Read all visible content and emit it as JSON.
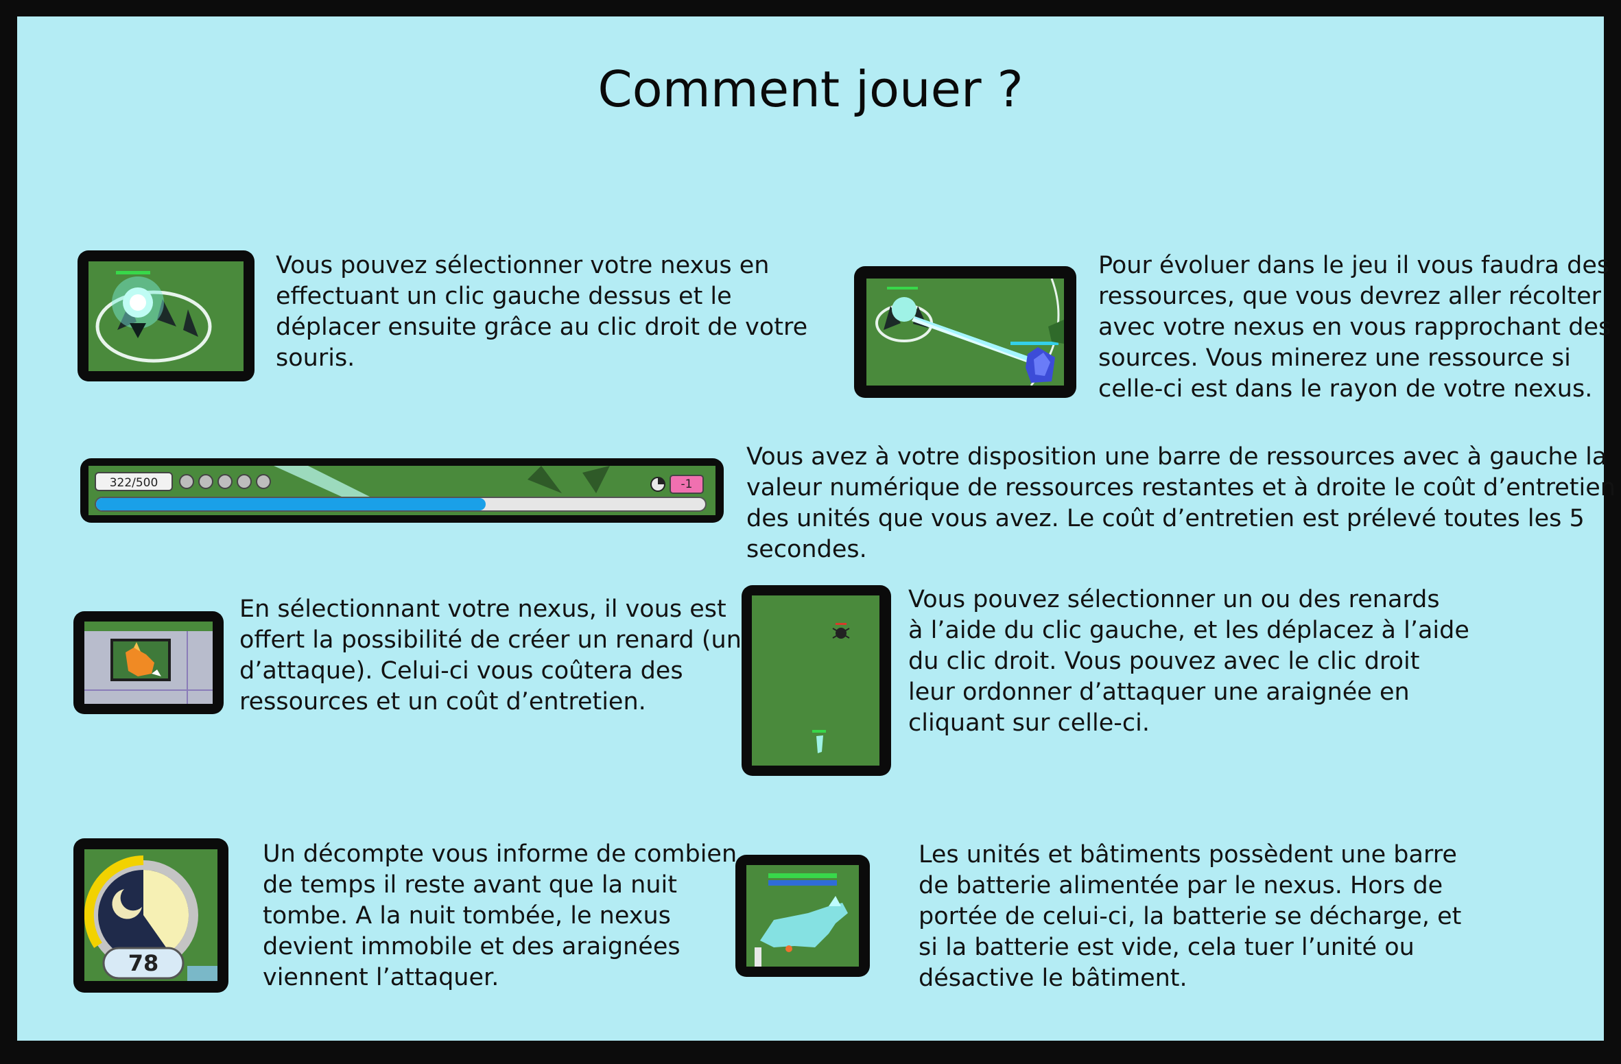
{
  "title": "Comment jouer ?",
  "sections": [
    {
      "text": "Vous pouvez sélectionner votre nexus en\neffectuant un clic gauche dessus et le\ndéplacer ensuite grâce au clic droit de votre\nsouris."
    },
    {
      "text": "Pour évoluer dans le jeu il vous faudra des\nressources, que vous devrez aller récolter\navec votre nexus en vous rapprochant des\nsources. Vous minerez une ressource si\ncelle-ci est dans le rayon de votre nexus."
    },
    {
      "text": "Vous avez à votre disposition une barre de ressources avec à gauche la\nvaleur numérique de ressources restantes et à droite le coût d’entretien\ndes unités que vous avez. Le coût d’entretien est prélevé toutes les 5\nsecondes."
    },
    {
      "text": "En sélectionnant votre nexus, il vous est\noffert la possibilité de créer un renard (unité\nd’attaque). Celui-ci vous coûtera des\nressources et un coût d’entretien."
    },
    {
      "text": "Vous pouvez sélectionner un ou des renards\nà l’aide du clic gauche, et les déplacez à l’aide\ndu clic droit. Vous pouvez avec le clic droit\nleur ordonner d’attaquer une araignée en\ncliquant sur celle-ci."
    },
    {
      "text": "Un décompte vous informe de combien\nde temps il reste avant que la nuit\ntombe. A la nuit tombée, le nexus\ndevient immobile et des araignées\nviennent l’attaquer."
    },
    {
      "text": "Les unités et bâtiments possèdent une barre\nde batterie alimentée par le nexus. Hors de\nportée de celui-ci, la batterie se décharge, et\nsi la batterie est vide, cela tuer l’unité ou\ndésactive le bâtiment."
    }
  ],
  "resource_bar": {
    "value_text": "322/500",
    "fill_fraction": 0.64,
    "upkeep_text": "-1"
  },
  "night_timer": {
    "value": "78"
  },
  "colors": {
    "panel": "#b4ecf4",
    "grass": "#4a8a3c",
    "frame": "#0b0b0b",
    "nexus_glow": "#bffcf4",
    "resource_fill": "#1aa0e8",
    "upkeep_badge": "#f070b0"
  }
}
